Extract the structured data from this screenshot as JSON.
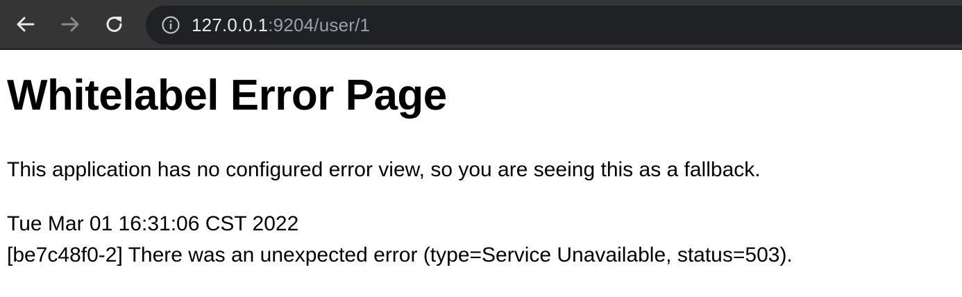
{
  "browser": {
    "url_host": "127.0.0.1",
    "url_rest": ":9204/user/1",
    "icons": {
      "back": "arrow-left-icon",
      "forward": "arrow-right-icon",
      "reload": "reload-icon",
      "site_info": "info-icon"
    },
    "colors": {
      "toolbar": "#353535",
      "omnibox": "#202124",
      "url_host": "#e8eaed",
      "url_rest": "#9aa0a6"
    }
  },
  "page": {
    "title": "Whitelabel Error Page",
    "message": "This application has no configured error view, so you are seeing this as a fallback.",
    "timestamp": "Tue Mar 01 16:31:06 CST 2022",
    "error_line": "[be7c48f0-2] There was an unexpected error (type=Service Unavailable, status=503)."
  }
}
